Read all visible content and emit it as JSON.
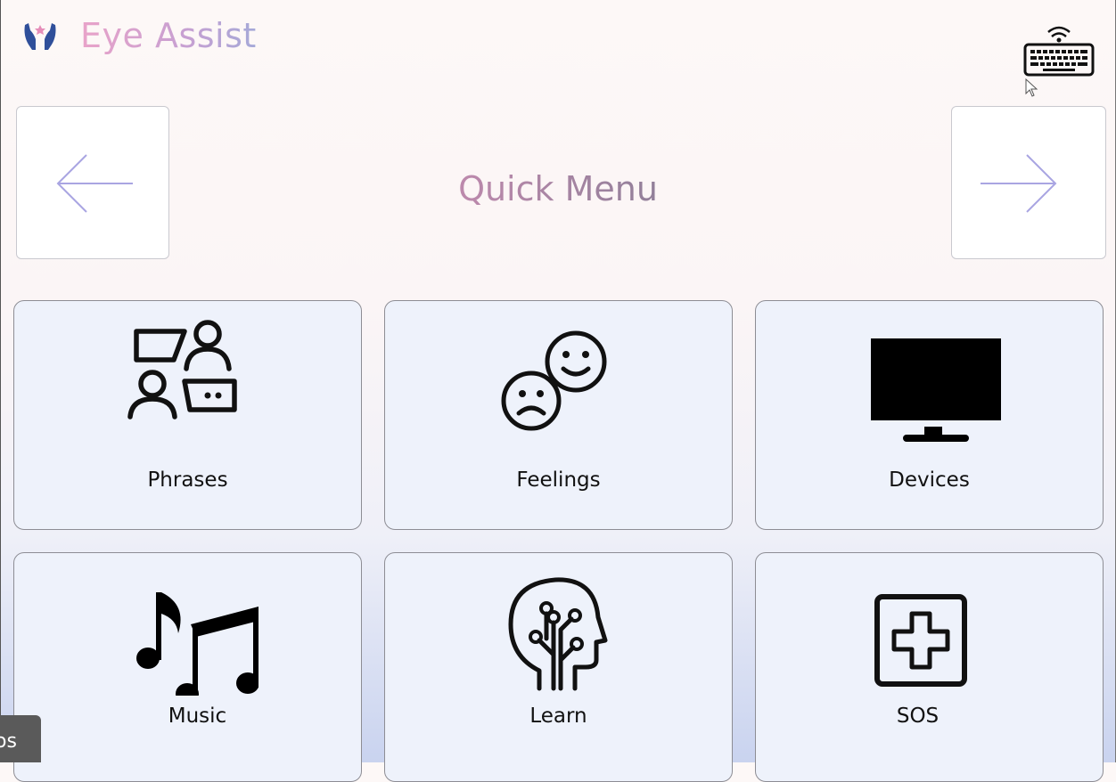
{
  "app": {
    "title": "Eye Assist"
  },
  "header": {
    "page_title": "Quick Menu",
    "prev_icon": "arrow-left-icon",
    "next_icon": "arrow-right-icon",
    "keyboard_icon": "wireless-keyboard-icon"
  },
  "tiles": [
    {
      "label": "Phrases",
      "icon": "conversation-icon"
    },
    {
      "label": "Feelings",
      "icon": "emotions-icon"
    },
    {
      "label": "Devices",
      "icon": "monitor-icon"
    },
    {
      "label": "Music",
      "icon": "music-notes-icon"
    },
    {
      "label": "Learn",
      "icon": "brain-head-icon"
    },
    {
      "label": "SOS",
      "icon": "medical-cross-icon"
    }
  ],
  "overlay": {
    "corner_text": "os"
  },
  "colors": {
    "accent": "#a5a3e0",
    "title_pink": "#e9a3c9",
    "tile_bg": "#eef2fb"
  }
}
